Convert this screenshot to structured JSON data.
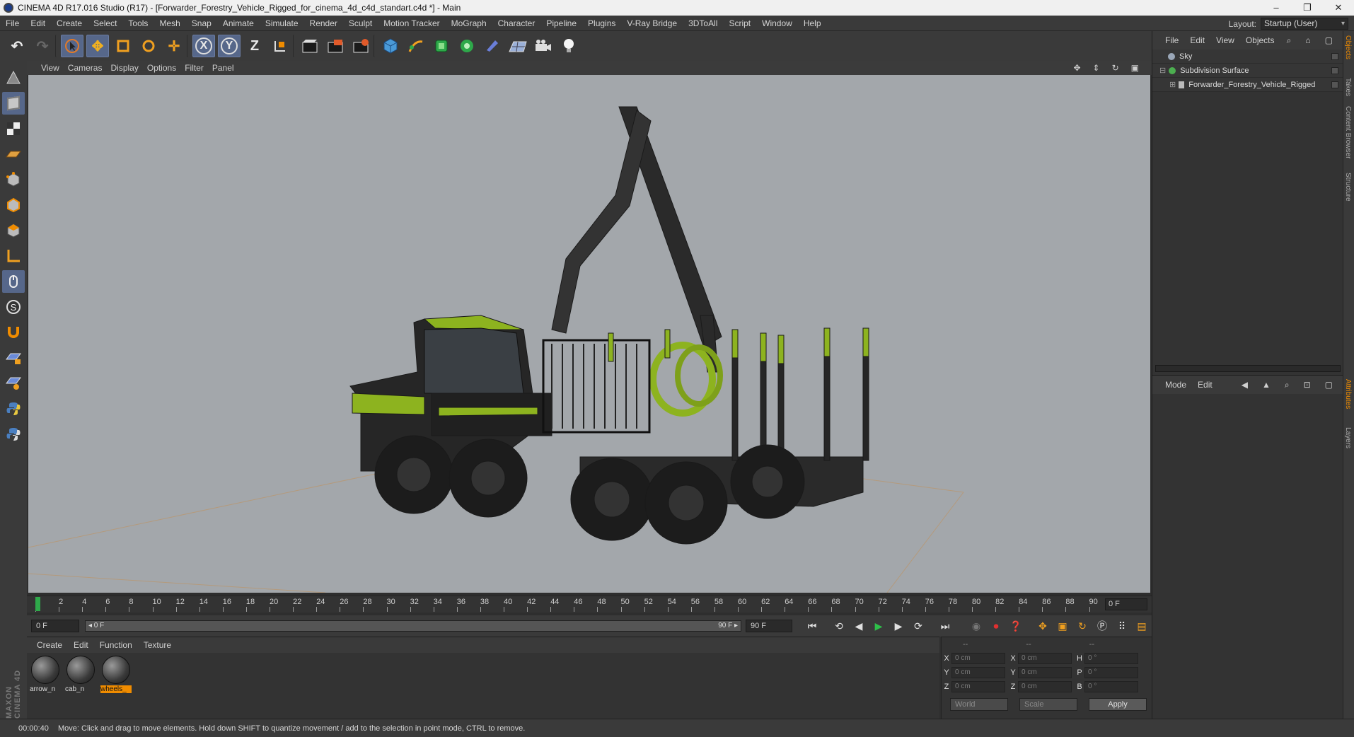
{
  "window": {
    "title": "CINEMA 4D R17.016 Studio (R17) - [Forwarder_Forestry_Vehicle_Rigged_for_cinema_4d_c4d_standart.c4d *] - Main",
    "minimize": "–",
    "restore": "❐",
    "close": "✕"
  },
  "menu": [
    "File",
    "Edit",
    "Create",
    "Select",
    "Tools",
    "Mesh",
    "Snap",
    "Animate",
    "Simulate",
    "Render",
    "Sculpt",
    "Motion Tracker",
    "MoGraph",
    "Character",
    "Pipeline",
    "Plugins",
    "V-Ray Bridge",
    "3DToAll",
    "Script",
    "Window",
    "Help"
  ],
  "layout": {
    "label": "Layout:",
    "value": "Startup (User)"
  },
  "toolbar": {
    "x": "X",
    "y": "Y",
    "z": "Z"
  },
  "viewport_menu": [
    "View",
    "Cameras",
    "Display",
    "Options",
    "Filter",
    "Panel"
  ],
  "timeline": {
    "ticks": [
      "0",
      "2",
      "4",
      "6",
      "8",
      "10",
      "12",
      "14",
      "16",
      "18",
      "20",
      "22",
      "24",
      "26",
      "28",
      "30",
      "32",
      "34",
      "36",
      "38",
      "40",
      "42",
      "44",
      "46",
      "48",
      "50",
      "52",
      "54",
      "56",
      "58",
      "60",
      "62",
      "64",
      "66",
      "68",
      "70",
      "72",
      "74",
      "76",
      "78",
      "80",
      "82",
      "84",
      "86",
      "88",
      "90"
    ],
    "current_frame": "0 F",
    "start": "0 F",
    "range_left": "◂ 0 F",
    "range_right": "90 F ▸",
    "end": "90 F"
  },
  "materials_menu": [
    "Create",
    "Edit",
    "Function",
    "Texture"
  ],
  "materials": [
    {
      "name": "arrow_n",
      "selected": false
    },
    {
      "name": "cab_n",
      "selected": false
    },
    {
      "name": "wheels_",
      "selected": true
    }
  ],
  "coords": {
    "headers": [
      "--",
      "--",
      "--"
    ],
    "rows": [
      {
        "a": "X",
        "av": "0 cm",
        "b": "X",
        "bv": "0 cm",
        "c": "H",
        "cv": "0 °"
      },
      {
        "a": "Y",
        "av": "0 cm",
        "b": "Y",
        "bv": "0 cm",
        "c": "P",
        "cv": "0 °"
      },
      {
        "a": "Z",
        "av": "0 cm",
        "b": "Z",
        "bv": "0 cm",
        "c": "B",
        "cv": "0 °"
      }
    ],
    "world": "World",
    "scale": "Scale",
    "apply": "Apply"
  },
  "objects_menu": [
    "File",
    "Edit",
    "View",
    "Objects"
  ],
  "objects": [
    {
      "name": "Sky",
      "color": "#9aa7b8"
    },
    {
      "name": "Subdivision Surface",
      "color": "#4caf50"
    },
    {
      "name": "Forwarder_Forestry_Vehicle_Rigged",
      "color": "#bbbbbb"
    }
  ],
  "attr_menu": [
    "Mode",
    "Edit"
  ],
  "right_tabs": [
    "Objects",
    "Takes",
    "Content Browser",
    "Structure",
    "Attributes",
    "Layers"
  ],
  "status": {
    "time": "00:00:40",
    "message": "Move: Click and drag to move elements. Hold down SHIFT to quantize movement / add to the selection in point mode, CTRL to remove."
  },
  "branding": "MAXON CINEMA 4D",
  "colors": {
    "accent": "#56678a",
    "vehicle_green": "#8db31f",
    "selection": "#f08c00"
  }
}
